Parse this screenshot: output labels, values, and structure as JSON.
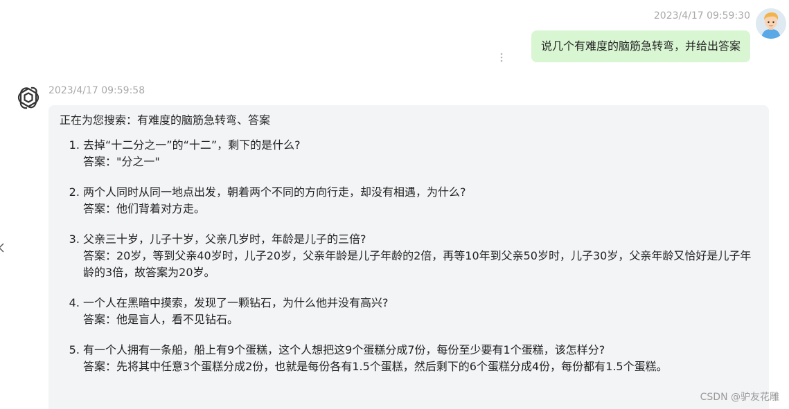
{
  "user": {
    "timestamp": "2023/4/17 09:59:30",
    "message": "说几个有难度的脑筋急转弯，并给出答案"
  },
  "bot": {
    "timestamp": "2023/4/17 09:59:58",
    "intro": "正在为您搜索：有难度的脑筋急转弯、答案",
    "items": [
      {
        "question": "去掉“十二分之一”的“十二”，剩下的是什么?",
        "answer": "答案：\"分之一\""
      },
      {
        "question": "两个人同时从同一地点出发，朝着两个不同的方向行走，却没有相遇，为什么?",
        "answer": "答案：他们背着对方走。"
      },
      {
        "question": "父亲三十岁，儿子十岁，父亲几岁时，年龄是儿子的三倍?",
        "answer": "答案：20岁，等到父亲40岁时，儿子20岁，父亲年龄是儿子年龄的2倍，再等10年到父亲50岁时，儿子30岁，父亲年龄又恰好是儿子年龄的3倍，故答案为20岁。"
      },
      {
        "question": "一个人在黑暗中摸索，发现了一颗钻石，为什么他并没有高兴?",
        "answer": "答案：他是盲人，看不见钻石。"
      },
      {
        "question": "有一个人拥有一条船，船上有9个蛋糕，这个人想把这9个蛋糕分成7份，每份至少要有1个蛋糕，该怎样分?",
        "answer": "答案：先将其中任意3个蛋糕分成2份，也就是每份各有1.5个蛋糕，然后剩下的6个蛋糕分成4份，每份都有1.5个蛋糕。"
      }
    ]
  },
  "watermark": "CSDN @驴友花雕",
  "colors": {
    "user_bubble": "#d9f6d3",
    "bot_bubble": "#f3f4f6",
    "timestamp": "#a8a8a8"
  },
  "icons": [
    "user-avatar-icon",
    "more-options-icon",
    "collapse-arrow-icon",
    "openai-logo-icon"
  ]
}
